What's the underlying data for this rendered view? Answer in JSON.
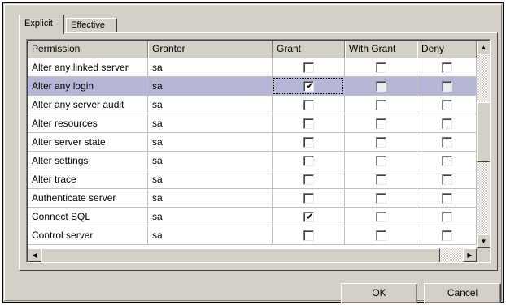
{
  "tabs": [
    {
      "label": "Explicit",
      "active": true
    },
    {
      "label": "Effective",
      "active": false
    }
  ],
  "table": {
    "columns": [
      "Permission",
      "Grantor",
      "Grant",
      "With Grant",
      "Deny"
    ],
    "rows": [
      {
        "permission": "Alter any linked server",
        "grantor": "sa",
        "grant": false,
        "with_grant": false,
        "deny": false,
        "selected": false
      },
      {
        "permission": "Alter any login",
        "grantor": "sa",
        "grant": true,
        "with_grant": false,
        "deny": false,
        "selected": true
      },
      {
        "permission": "Alter any server audit",
        "grantor": "sa",
        "grant": false,
        "with_grant": false,
        "deny": false,
        "selected": false
      },
      {
        "permission": "Alter resources",
        "grantor": "sa",
        "grant": false,
        "with_grant": false,
        "deny": false,
        "selected": false
      },
      {
        "permission": "Alter server state",
        "grantor": "sa",
        "grant": false,
        "with_grant": false,
        "deny": false,
        "selected": false
      },
      {
        "permission": "Alter settings",
        "grantor": "sa",
        "grant": false,
        "with_grant": false,
        "deny": false,
        "selected": false
      },
      {
        "permission": "Alter trace",
        "grantor": "sa",
        "grant": false,
        "with_grant": false,
        "deny": false,
        "selected": false
      },
      {
        "permission": "Authenticate server",
        "grantor": "sa",
        "grant": false,
        "with_grant": false,
        "deny": false,
        "selected": false
      },
      {
        "permission": "Connect SQL",
        "grantor": "sa",
        "grant": true,
        "with_grant": false,
        "deny": false,
        "selected": false
      },
      {
        "permission": "Control server",
        "grantor": "sa",
        "grant": false,
        "with_grant": false,
        "deny": false,
        "selected": false
      }
    ]
  },
  "scrollbars": {
    "up_icon": "arrow-up-icon",
    "down_icon": "arrow-down-icon",
    "left_icon": "arrow-left-icon",
    "right_icon": "arrow-right-icon",
    "vertical_position": 0.4,
    "horizontal_position": 0
  },
  "buttons": {
    "ok_label": "OK",
    "cancel_label": "Cancel"
  },
  "colors": {
    "face": "#d4d0c8",
    "selection": "#b6b6d6"
  }
}
